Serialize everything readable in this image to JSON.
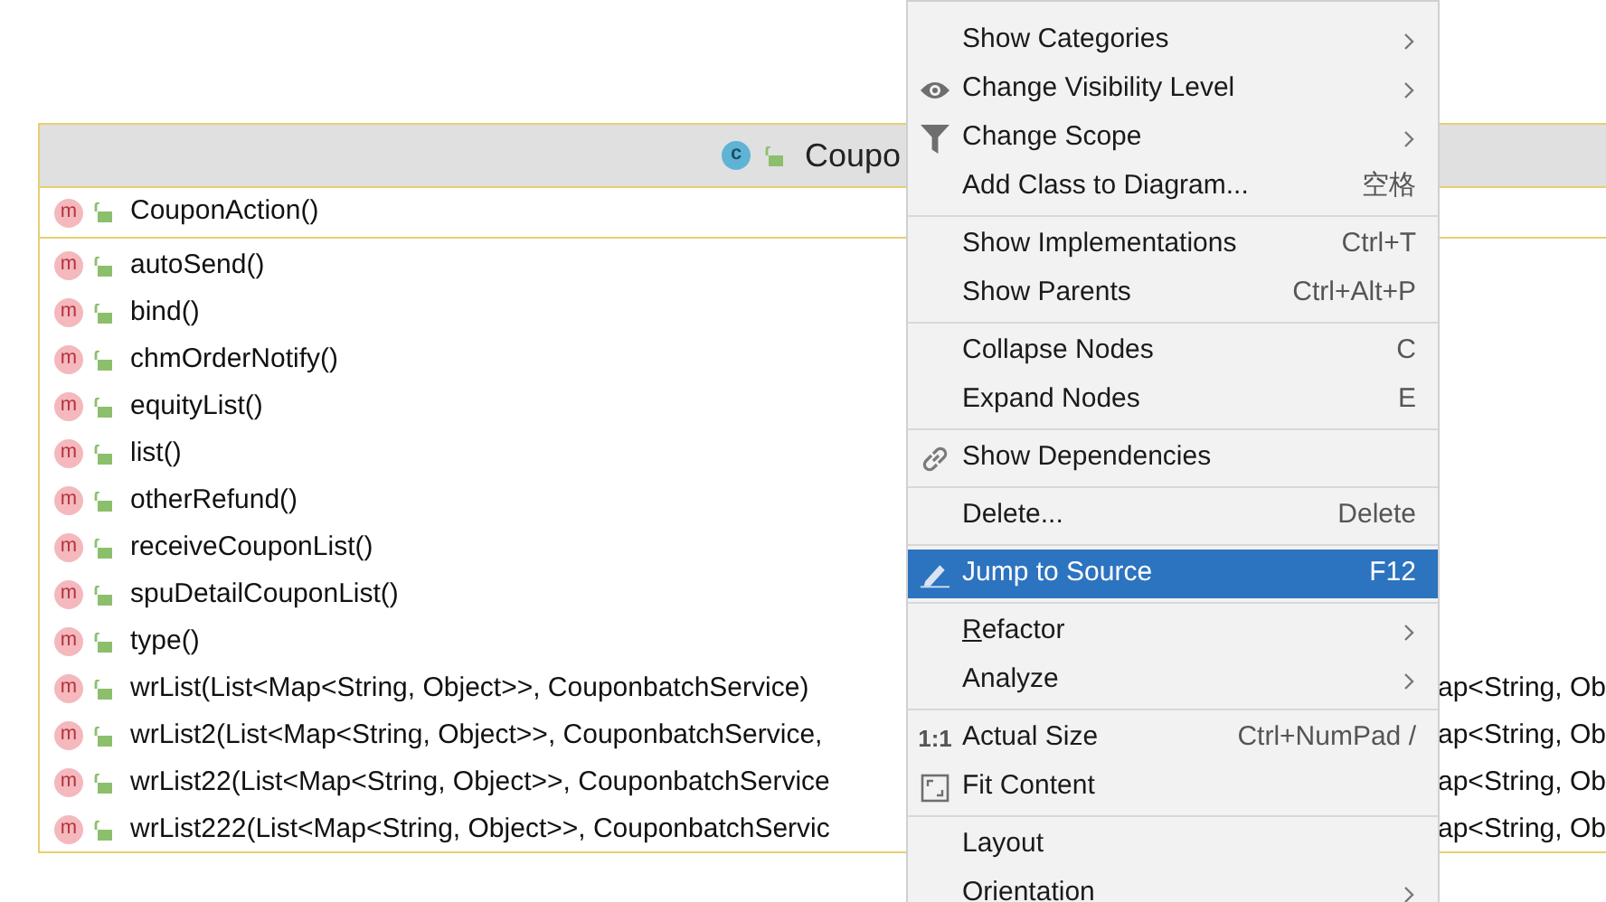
{
  "class_node": {
    "icon_text": "c",
    "title": "Coupo",
    "constructor": {
      "icon_text": "m",
      "name": "CouponAction()"
    },
    "methods": [
      {
        "icon_text": "m",
        "name": "autoSend()"
      },
      {
        "icon_text": "m",
        "name": "bind()"
      },
      {
        "icon_text": "m",
        "name": "chmOrderNotify()"
      },
      {
        "icon_text": "m",
        "name": "equityList()"
      },
      {
        "icon_text": "m",
        "name": "list()"
      },
      {
        "icon_text": "m",
        "name": "otherRefund()"
      },
      {
        "icon_text": "m",
        "name": "receiveCouponList()"
      },
      {
        "icon_text": "m",
        "name": "spuDetailCouponList()"
      },
      {
        "icon_text": "m",
        "name": "type()"
      },
      {
        "icon_text": "m",
        "name": "wrList(List<Map<String, Object>>, CouponbatchService)",
        "continuation": "ap<String, Ob"
      },
      {
        "icon_text": "m",
        "name": "wrList2(List<Map<String, Object>>, CouponbatchService,",
        "continuation": "ap<String, Ob"
      },
      {
        "icon_text": "m",
        "name": "wrList22(List<Map<String, Object>>, CouponbatchService",
        "continuation": "ap<String, Ob"
      },
      {
        "icon_text": "m",
        "name": "wrList222(List<Map<String, Object>>, CouponbatchServic",
        "continuation": "ap<String, Ob"
      }
    ]
  },
  "context_menu": {
    "groups": [
      [
        {
          "label": "Show Categories",
          "submenu": true,
          "selected": false
        },
        {
          "label": "Change Visibility Level",
          "kind": "eye",
          "submenu": true,
          "selected": false
        },
        {
          "label": "Change Scope",
          "kind": "filter",
          "submenu": true,
          "selected": false
        },
        {
          "label": "Add Class to Diagram...",
          "shortcut": "空格",
          "selected": false
        }
      ],
      [
        {
          "label": "Show Implementations",
          "shortcut": "Ctrl+T",
          "selected": false
        },
        {
          "label": "Show Parents",
          "shortcut": "Ctrl+Alt+P",
          "selected": false
        }
      ],
      [
        {
          "label": "Collapse Nodes",
          "shortcut": "C",
          "selected": false
        },
        {
          "label": "Expand Nodes",
          "shortcut": "E",
          "selected": false
        }
      ],
      [
        {
          "label": "Show Dependencies",
          "kind": "link",
          "selected": false
        }
      ],
      [
        {
          "label": "Delete...",
          "shortcut": "Delete",
          "selected": false
        }
      ],
      [
        {
          "label": "Jump to Source",
          "kind": "pencil",
          "shortcut": "F12",
          "selected": true
        }
      ],
      [
        {
          "label": "Refactor",
          "submenu": true,
          "mnemonic_underlined": true,
          "selected": false
        },
        {
          "label": "Analyze",
          "submenu": true,
          "selected": false
        }
      ],
      [
        {
          "label": "Actual Size",
          "icon_text": "1:1",
          "shortcut": "Ctrl+NumPad /",
          "selected": false
        },
        {
          "label": "Fit Content",
          "kind": "fit",
          "selected": false
        }
      ],
      [
        {
          "label": "Layout",
          "selected": false
        },
        {
          "label": "Orientation",
          "submenu": true,
          "selected": false
        }
      ]
    ]
  }
}
